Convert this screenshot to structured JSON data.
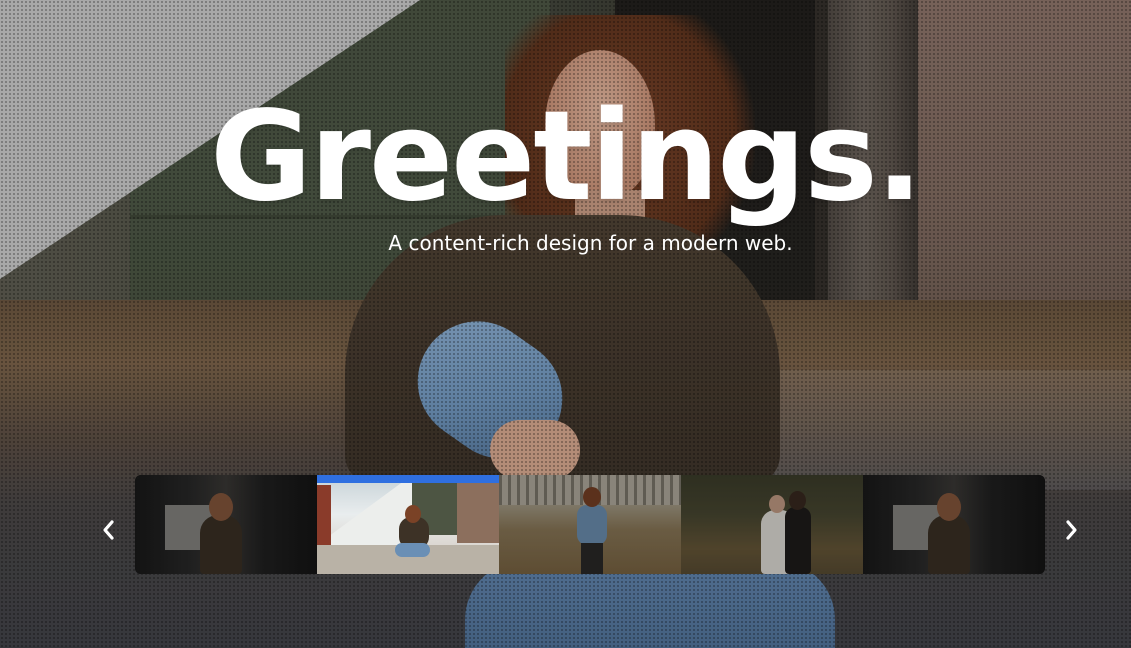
{
  "hero": {
    "headline": "Greetings.",
    "subline": "A content-rich design for a modern web."
  },
  "carousel": {
    "active_index": 1,
    "accent_color": "#2f6fe0",
    "thumbnails": [
      {
        "subject": "woman-dark-interior"
      },
      {
        "subject": "woman-sitting-ramp"
      },
      {
        "subject": "woman-grass-field"
      },
      {
        "subject": "wedding-couple"
      },
      {
        "subject": "woman-dark-interior"
      }
    ],
    "prev_icon": "chevron-left-icon",
    "next_icon": "chevron-right-icon"
  }
}
